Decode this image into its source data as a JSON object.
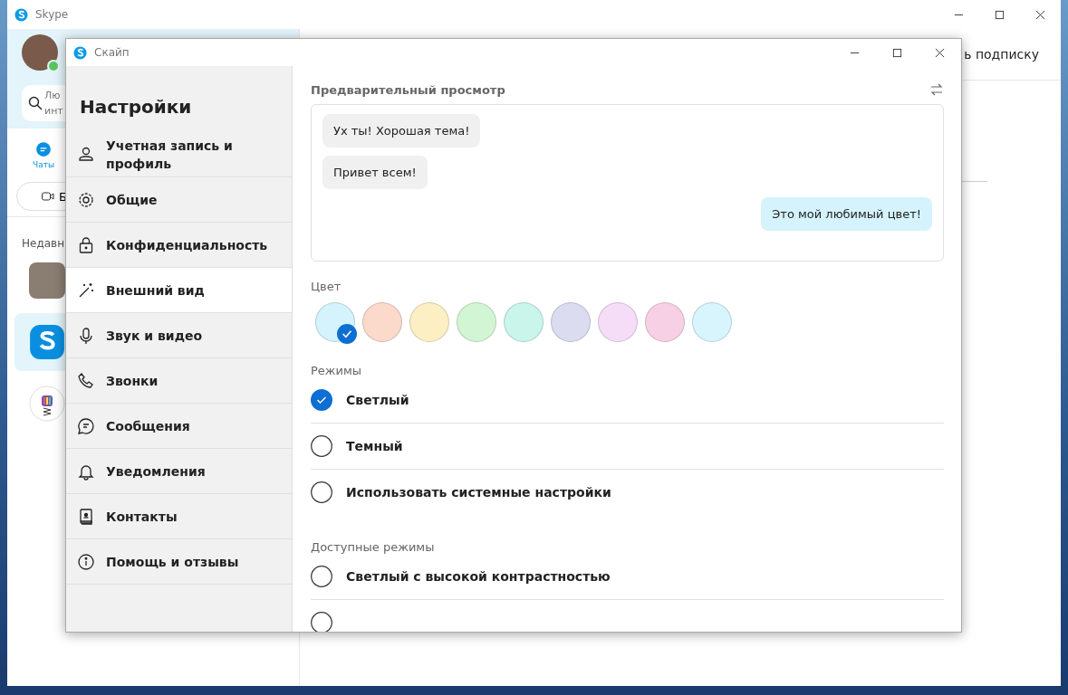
{
  "main_window": {
    "title": "Skype",
    "search_placeholder_visible": "Лю\nинт",
    "chats_tab": {
      "label": "Чаты",
      "selected": true
    },
    "call_button_visible": "Б",
    "recent_label_visible": "Недавн",
    "subscription_visible": "ь подписку",
    "contacts": [
      {
        "kind": "photo",
        "selected": false
      },
      {
        "kind": "logo",
        "selected": true
      },
      {
        "kind": "bot",
        "selected": false
      }
    ]
  },
  "dialog": {
    "title": "Скайп",
    "heading": "Настройки",
    "nav": [
      {
        "label": "Учетная запись и профиль",
        "selected": false
      },
      {
        "label": "Общие",
        "selected": false
      },
      {
        "label": "Конфиденциальность",
        "selected": false
      },
      {
        "label": "Внешний вид",
        "selected": true
      },
      {
        "label": "Звук и видео",
        "selected": false
      },
      {
        "label": "Звонки",
        "selected": false
      },
      {
        "label": "Сообщения",
        "selected": false
      },
      {
        "label": "Уведомления",
        "selected": false
      },
      {
        "label": "Контакты",
        "selected": false
      },
      {
        "label": "Помощь и отзывы",
        "selected": false
      }
    ],
    "preview_label": "Предварительный просмотр",
    "messages": [
      {
        "text": "Ух ты! Хорошая тема!",
        "outgoing": false
      },
      {
        "text": "Привет всем!",
        "outgoing": false
      },
      {
        "text": "Это мой любимый цвет!",
        "outgoing": true
      }
    ],
    "color_label": "Цвет",
    "swatches": [
      {
        "color": "#d4f3fc",
        "selected": true
      },
      {
        "color": "#fbd9cb",
        "selected": false
      },
      {
        "color": "#fdefc4",
        "selected": false
      },
      {
        "color": "#d2f5d3",
        "selected": false
      },
      {
        "color": "#c9f5ea",
        "selected": false
      },
      {
        "color": "#dcdcf0",
        "selected": false
      },
      {
        "color": "#f5dcf7",
        "selected": false
      },
      {
        "color": "#f8d0e6",
        "selected": false
      },
      {
        "color": "#d8f5fd",
        "selected": false
      }
    ],
    "modes_label": "Режимы",
    "modes": [
      {
        "label": "Светлый",
        "selected": true
      },
      {
        "label": "Темный",
        "selected": false
      },
      {
        "label": "Использовать системные настройки",
        "selected": false
      }
    ],
    "available_label": "Доступные режимы",
    "available_modes": [
      {
        "label": "Светлый с высокой контрастностью",
        "selected": false
      },
      {
        "selected": false
      }
    ]
  }
}
